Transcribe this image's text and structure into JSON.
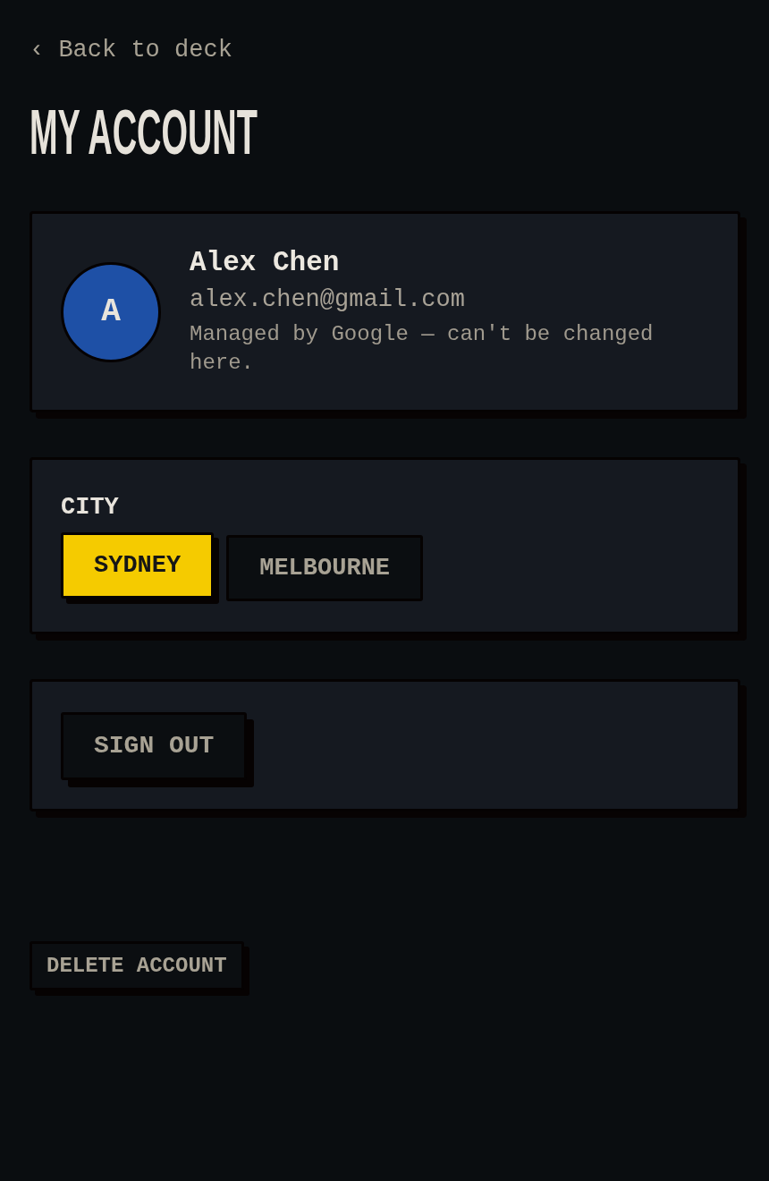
{
  "back_link": {
    "label": "‹ Back to deck"
  },
  "title": "MY ACCOUNT",
  "profile": {
    "avatar_initial": "A",
    "name": "Alex Chen",
    "email": "alex.chen@gmail.com",
    "note": "Managed by Google — can't be changed here."
  },
  "city": {
    "label": "CITY",
    "options": [
      {
        "label": "SYDNEY",
        "selected": true
      },
      {
        "label": "MELBOURNE",
        "selected": false
      }
    ]
  },
  "sign_out": {
    "label": "SIGN OUT"
  },
  "delete_account": {
    "label": "DELETE ACCOUNT"
  }
}
